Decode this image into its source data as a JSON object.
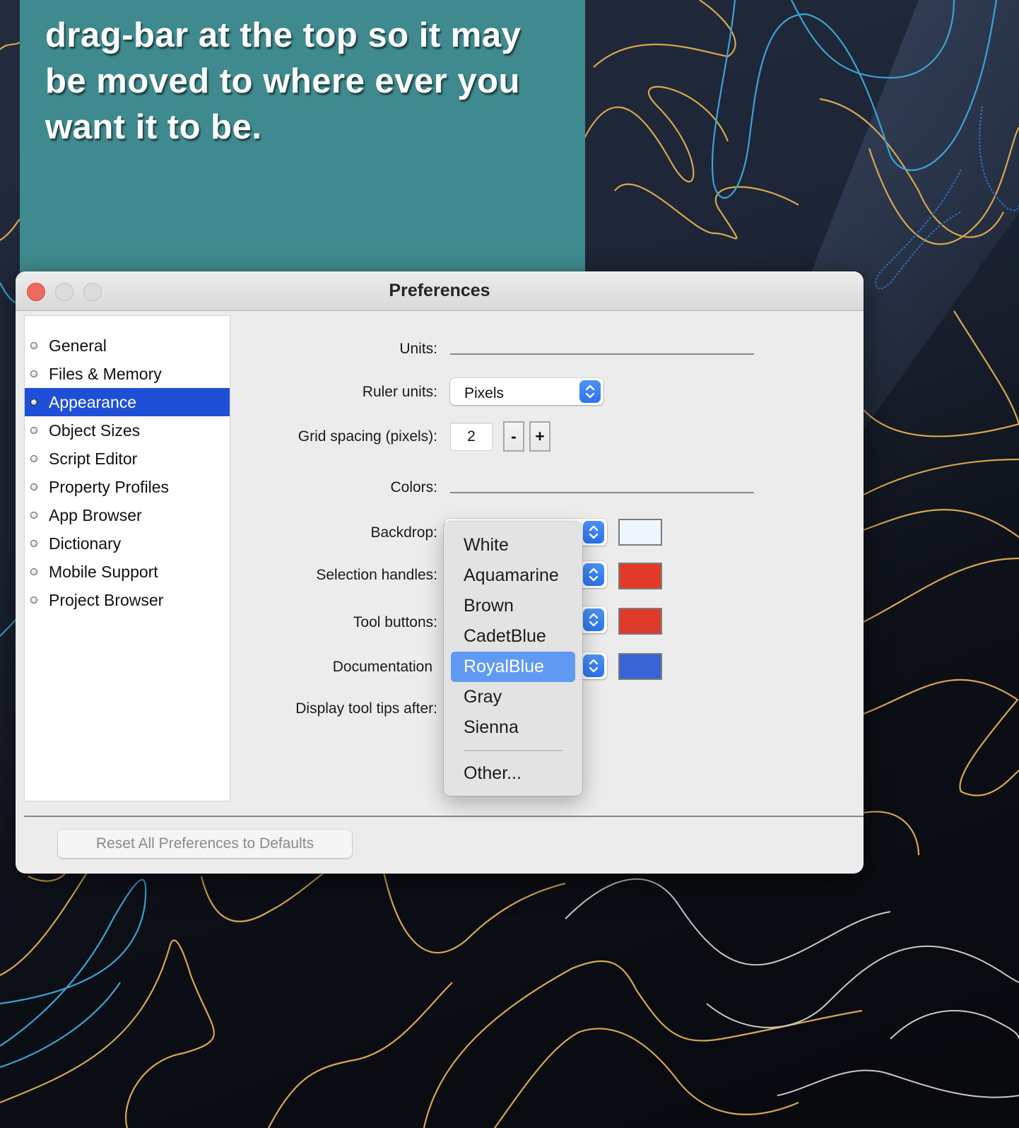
{
  "note": {
    "lines": [
      "drag-bar at the top so it may",
      "be moved to where ever you",
      "want it to be."
    ]
  },
  "window": {
    "title": "Preferences",
    "buttons": {
      "close": "close",
      "minimize": "minimize",
      "zoom": "zoom"
    }
  },
  "sidebar": {
    "items": [
      {
        "label": "General",
        "selected": false
      },
      {
        "label": "Files & Memory",
        "selected": false
      },
      {
        "label": "Appearance",
        "selected": true
      },
      {
        "label": "Object Sizes",
        "selected": false
      },
      {
        "label": "Script Editor",
        "selected": false
      },
      {
        "label": "Property Profiles",
        "selected": false
      },
      {
        "label": "App Browser",
        "selected": false
      },
      {
        "label": "Dictionary",
        "selected": false
      },
      {
        "label": "Mobile Support",
        "selected": false
      },
      {
        "label": "Project Browser",
        "selected": false
      }
    ]
  },
  "form": {
    "units_label": "Units:",
    "ruler_units_label": "Ruler units:",
    "ruler_units_value": "Pixels",
    "grid_spacing_label": "Grid spacing (pixels):",
    "grid_spacing_value": "2",
    "minus_label": "-",
    "plus_label": "+",
    "colors_label": "Colors:",
    "backdrop_label": "Backdrop:",
    "selection_handles_label": "Selection handles:",
    "tool_buttons_label": "Tool buttons:",
    "documentation_label": "Documentation",
    "tooltips_label": "Display tool tips after:",
    "swatches": {
      "backdrop": "#eef5fe",
      "selection_handles": "#e03a2b",
      "tool_buttons": "#e03a2b",
      "documentation": "#3763d4"
    }
  },
  "menu": {
    "items": [
      "White",
      "Aquamarine",
      "Brown",
      "CadetBlue",
      "RoyalBlue",
      "Gray",
      "Sienna"
    ],
    "highlighted": "RoyalBlue",
    "other": "Other..."
  },
  "footer": {
    "reset_label": "Reset All Preferences to Defaults"
  },
  "colors": {
    "selection_accent": "#1e4fd6",
    "menu_highlight": "#609af3",
    "note_background": "#3f8a8e"
  }
}
